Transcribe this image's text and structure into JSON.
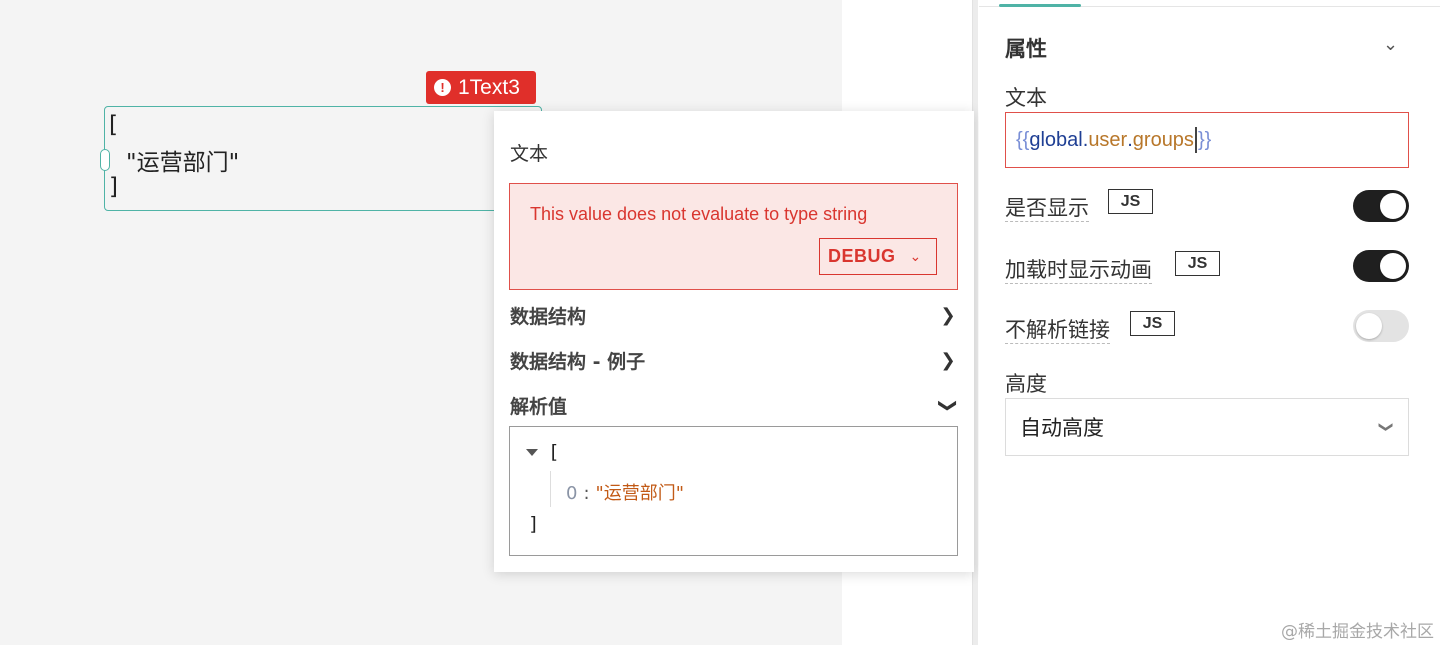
{
  "canvas": {
    "widget_badge": "1Text3",
    "widget_lines": [
      "[",
      "\"运营部门\"",
      "]"
    ]
  },
  "popover": {
    "title": "文本",
    "error_message": "This value does not evaluate to type string",
    "debug_label": "DEBUG",
    "sections": [
      {
        "label": "数据结构",
        "state": "collapsed"
      },
      {
        "label": "数据结构 - 例子",
        "state": "collapsed"
      },
      {
        "label": "解析值",
        "state": "expanded"
      }
    ],
    "evaluated": {
      "open_bracket": "[",
      "close_bracket": "]",
      "items": [
        {
          "key": "0",
          "value": "\"运营部门\""
        }
      ]
    }
  },
  "panel": {
    "section_title": "属性",
    "text_label": "文本",
    "text_binding": {
      "open": "{{",
      "global": "global",
      "dot1": ".",
      "user": "user",
      "dot2": ".",
      "groups": "groups",
      "close": "}}"
    },
    "properties": [
      {
        "label": "是否显示",
        "js": "JS",
        "toggle": "on"
      },
      {
        "label": "加载时显示动画",
        "js": "JS",
        "toggle": "on"
      },
      {
        "label": "不解析链接",
        "js": "JS",
        "toggle": "off"
      }
    ],
    "height_label": "高度",
    "height_value": "自动高度"
  },
  "watermark": "@稀土掘金技术社区",
  "colors": {
    "accent": "#4fb3a6",
    "error": "#e0504a",
    "toggle_on": "#1f1f1f"
  }
}
